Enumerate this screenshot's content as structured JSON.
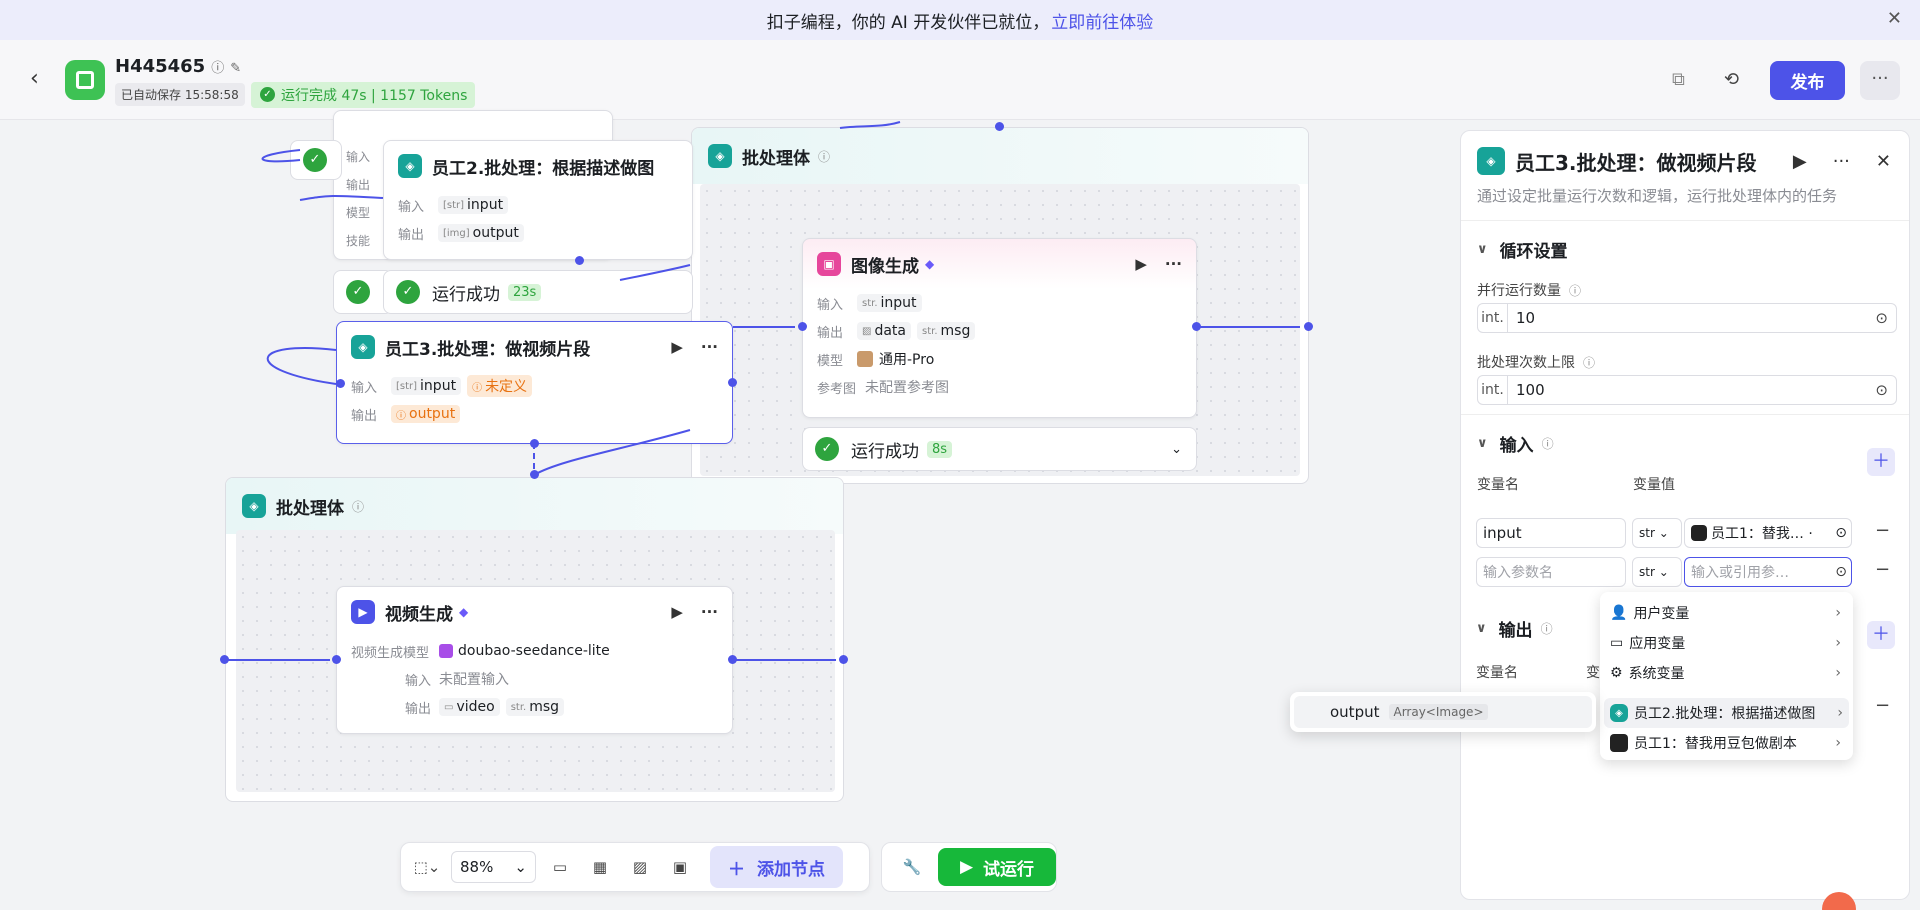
{
  "banner": {
    "text": "扣子编程，你的 AI 开发伙伴已就位，",
    "link": "立即前往体验"
  },
  "header": {
    "title": "H445465",
    "autosave": "已自动保存 15:58:58",
    "run_status": "运行完成 47s | 1157 Tokens",
    "publish": "发布"
  },
  "nodes": {
    "batch_top": {
      "title": "批处理体"
    },
    "emp2": {
      "title": "员工2.批处理：根据描述做图",
      "in_label": "输入",
      "out_label": "输出",
      "in_val": "input",
      "out_val": "output",
      "model_label": "模型",
      "skill_label": "技能",
      "status": "运行成功",
      "dur": "23s"
    },
    "emp3": {
      "title": "员工3.批处理：做视频片段",
      "in_label": "输入",
      "out_label": "输出",
      "in_val": "input",
      "undefined": "未定义",
      "out_val": "output"
    },
    "img": {
      "title": "图像生成",
      "in_label": "输入",
      "out_label": "输出",
      "model_label": "模型",
      "ref_label": "参考图",
      "in_val": "input",
      "out1": "data",
      "out2": "msg",
      "model": "通用-Pro",
      "ref": "未配置参考图",
      "status": "运行成功",
      "dur": "8s"
    },
    "batch_bottom": {
      "title": "批处理体"
    },
    "video": {
      "title": "视频生成",
      "model_label": "视频生成模型",
      "model": "doubao-seedance-lite",
      "in_label": "输入",
      "in_val": "未配置输入",
      "out_label": "输出",
      "out1": "video",
      "out2": "msg"
    },
    "partial_status": {
      "status_left": "运行成功"
    }
  },
  "toolbar": {
    "zoom": "88%",
    "add_node": "添加节点",
    "trial_run": "试运行"
  },
  "panel": {
    "title": "员工3.批处理：做视频片段",
    "desc": "通过设定批量运行次数和逻辑，运行批处理体内的任务",
    "loop_section": "循环设置",
    "parallel_label": "并行运行数量",
    "parallel_prefix": "int.",
    "parallel_value": "10",
    "limit_label": "批处理次数上限",
    "limit_prefix": "int.",
    "limit_value": "100",
    "input_section": "输入",
    "var_name_col": "变量名",
    "var_value_col": "变量值",
    "row1_name": "input",
    "row1_type": "str",
    "row1_value": "员工1：替我… ·",
    "row2_name_placeholder": "输入参数名",
    "row2_type": "str",
    "row2_value_placeholder": "输入或引用参…",
    "output_section": "输出",
    "out_var_name_col": "变量名",
    "out_var_value_col": "变"
  },
  "menu": {
    "items": [
      "用户变量",
      "应用变量",
      "系统变量"
    ],
    "ref1": "员工2.批处理：根据描述做图",
    "ref2": "员工1：替我用豆包做剧本"
  },
  "submenu": {
    "name": "output",
    "type": "Array<Image>"
  }
}
